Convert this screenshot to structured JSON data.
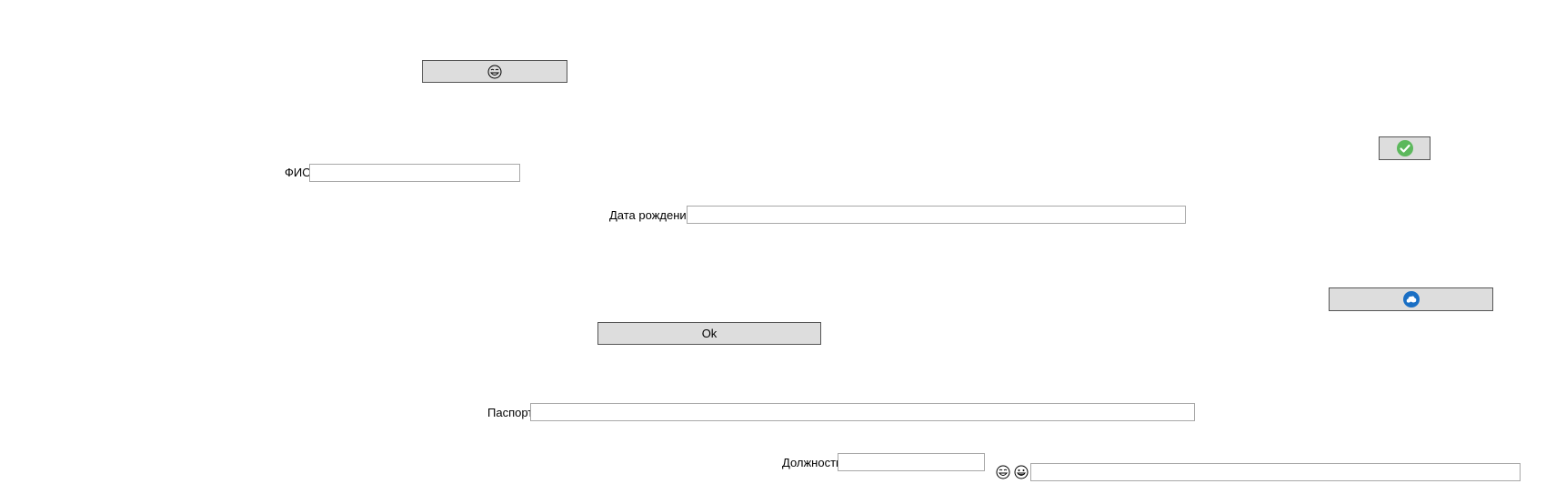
{
  "buttons": {
    "laugh_button_icon": "laughing-face-icon",
    "check_button_icon": "green-checkmark-icon",
    "cloud_button_icon": "blue-cloud-icon",
    "ok_label": "Ok"
  },
  "form": {
    "fio_label": "ФИО",
    "fio_value": "",
    "birth_label": "Дата рождения",
    "birth_value": "",
    "passport_label": "Паспорт",
    "passport_value": "",
    "position_label": "Должность",
    "position_value": "",
    "extra_value": ""
  },
  "icons": {
    "emoji_1": "laughing-face-icon",
    "emoji_2": "grinning-face-icon"
  },
  "colors": {
    "button_bg": "#dddddd",
    "check_green": "#5cb85c",
    "cloud_blue": "#1a6fc4"
  }
}
